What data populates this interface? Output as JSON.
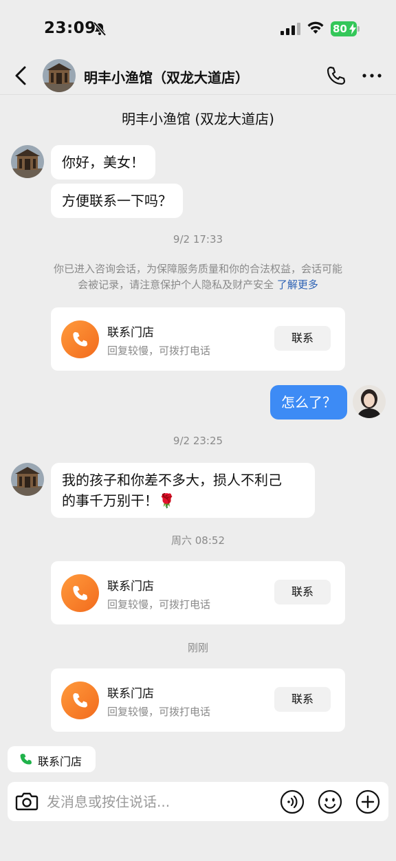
{
  "status_bar": {
    "time": "23:09",
    "battery": "80"
  },
  "header": {
    "title": "明丰小渔馆（双龙大道店）"
  },
  "shop_name": "明丰小渔馆 (双龙大道店)",
  "messages": {
    "m1": "你好，美女！",
    "m2": "方便联系一下吗？",
    "time1": "9/2 17:33",
    "notice_line1": "你已进入咨询会话，为保障服务质量和你的合法权益，会话可能",
    "notice_line2": "会被记录，请注意保护个人隐私及财产安全",
    "notice_link": "了解更多",
    "self_msg": "怎么了？",
    "time2": "9/2 23:25",
    "m3_line1": "我的孩子和你差不多大，损人不利己",
    "m3_line2": "的事千万别干！🌹",
    "time3": "周六 08:52",
    "time4": "刚刚"
  },
  "card": {
    "title": "联系门店",
    "subtitle": "回复较慢，可拨打电话",
    "button": "联系"
  },
  "quick_chip": {
    "label": "联系门店"
  },
  "input": {
    "placeholder": "发消息或按住说话..."
  },
  "colors": {
    "self_bubble": "#3d8bf5",
    "card_icon": "#f57c2a",
    "battery": "#34c759",
    "link": "#2d62b5"
  }
}
